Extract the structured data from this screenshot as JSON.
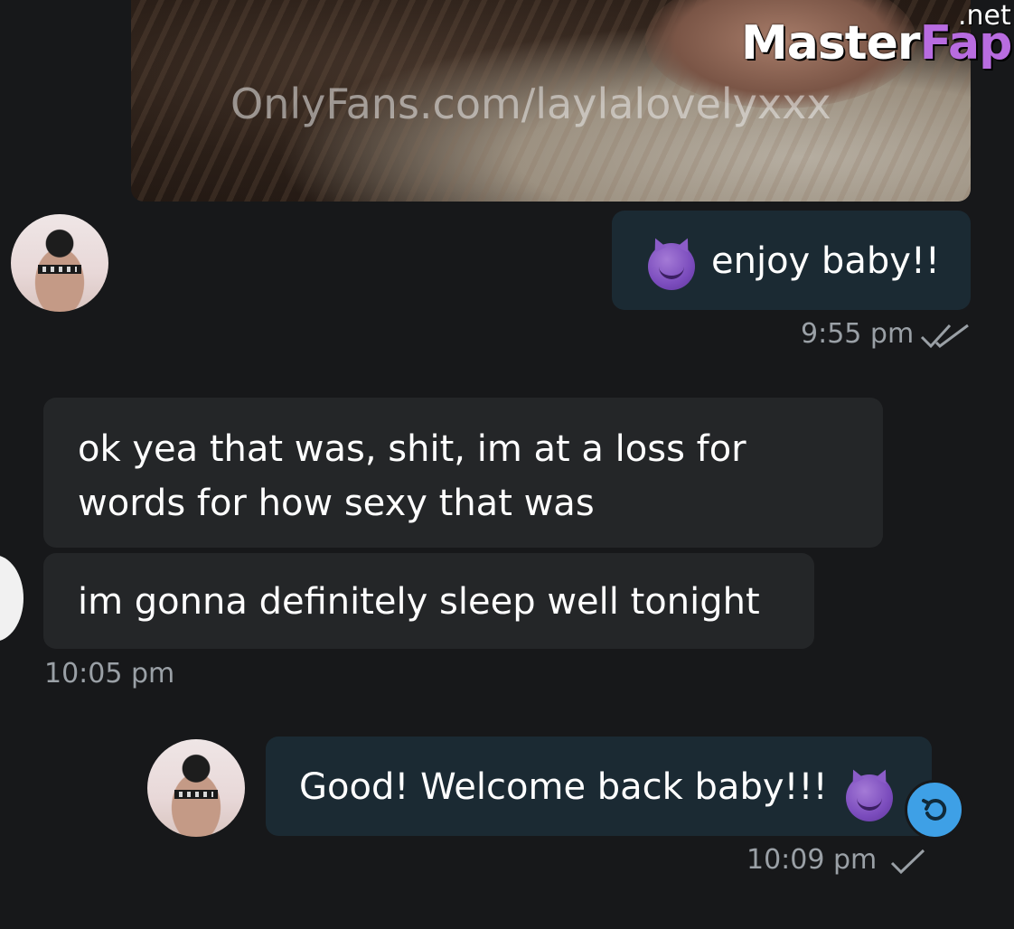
{
  "media": {
    "watermark": "OnlyFans.com/laylalovelyxxx"
  },
  "logo": {
    "main": "Master",
    "accent": "Fap",
    "suffix": ".net"
  },
  "messages": [
    {
      "id": "m1",
      "direction": "outgoing",
      "text": "enjoy baby!!",
      "emoji": "smiling-devil",
      "time": "9:55 pm",
      "status": "read"
    },
    {
      "id": "m2",
      "direction": "incoming",
      "text_line1": "ok yea that was, shit, im at a loss for",
      "text_line2": "words for how sexy that was"
    },
    {
      "id": "m3",
      "direction": "incoming",
      "text": "im gonna definitely sleep well tonight",
      "time": "10:05 pm"
    },
    {
      "id": "m4",
      "direction": "outgoing",
      "text": "Good! Welcome back baby!!!",
      "emoji": "smiling-devil",
      "time": "10:09 pm",
      "status": "sent"
    }
  ],
  "colors": {
    "background": "#17181a",
    "outgoing_bubble": "#1b2a33",
    "incoming_bubble": "#242628",
    "timestamp": "#9aa0a6",
    "reply_button": "#3ea0e6"
  }
}
